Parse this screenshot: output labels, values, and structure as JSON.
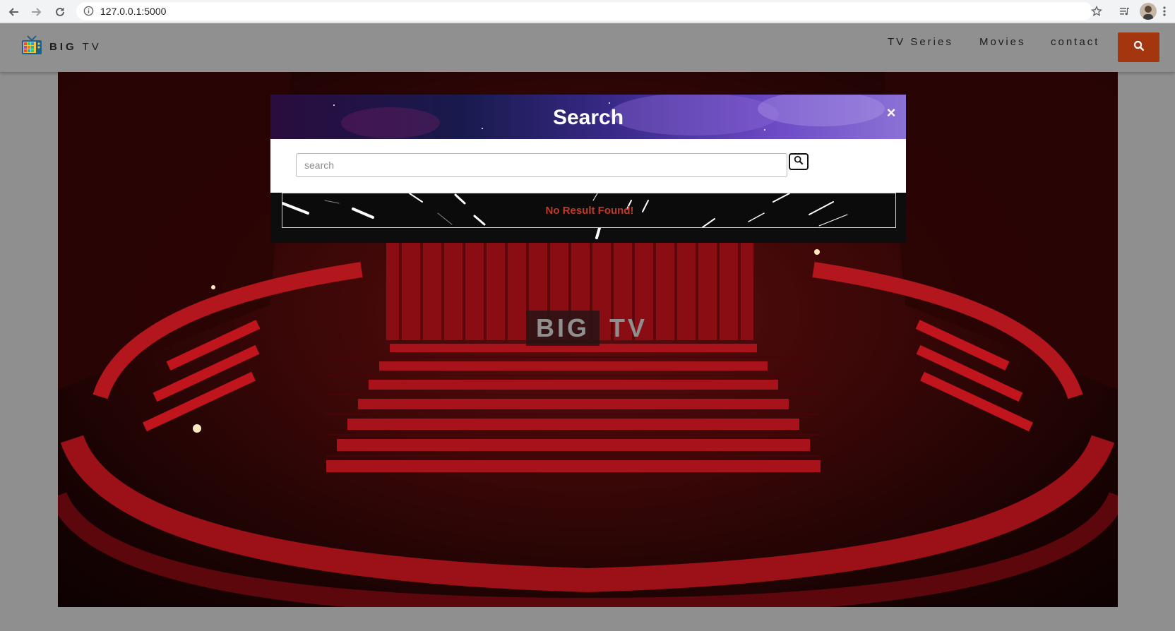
{
  "browser": {
    "url": "127.0.0.1:5000",
    "icons": [
      "back-arrow-icon",
      "forward-arrow-icon",
      "reload-icon",
      "info-icon",
      "star-icon",
      "media-queue-icon",
      "profile-avatar",
      "more-menu-icon"
    ]
  },
  "header": {
    "logo_bold": "BIG",
    "logo_light": "TV",
    "nav": [
      "TV Series",
      "Movies",
      "contact"
    ],
    "search_icon": "search-icon",
    "accent_color": "#a4360f"
  },
  "hero": {
    "title_bold": "BIG",
    "title_light": "TV"
  },
  "modal": {
    "title": "Search",
    "close_label": "×",
    "search_placeholder": "search",
    "search_value": "",
    "result_message": "No Result Found!",
    "result_color": "#c0392b"
  }
}
